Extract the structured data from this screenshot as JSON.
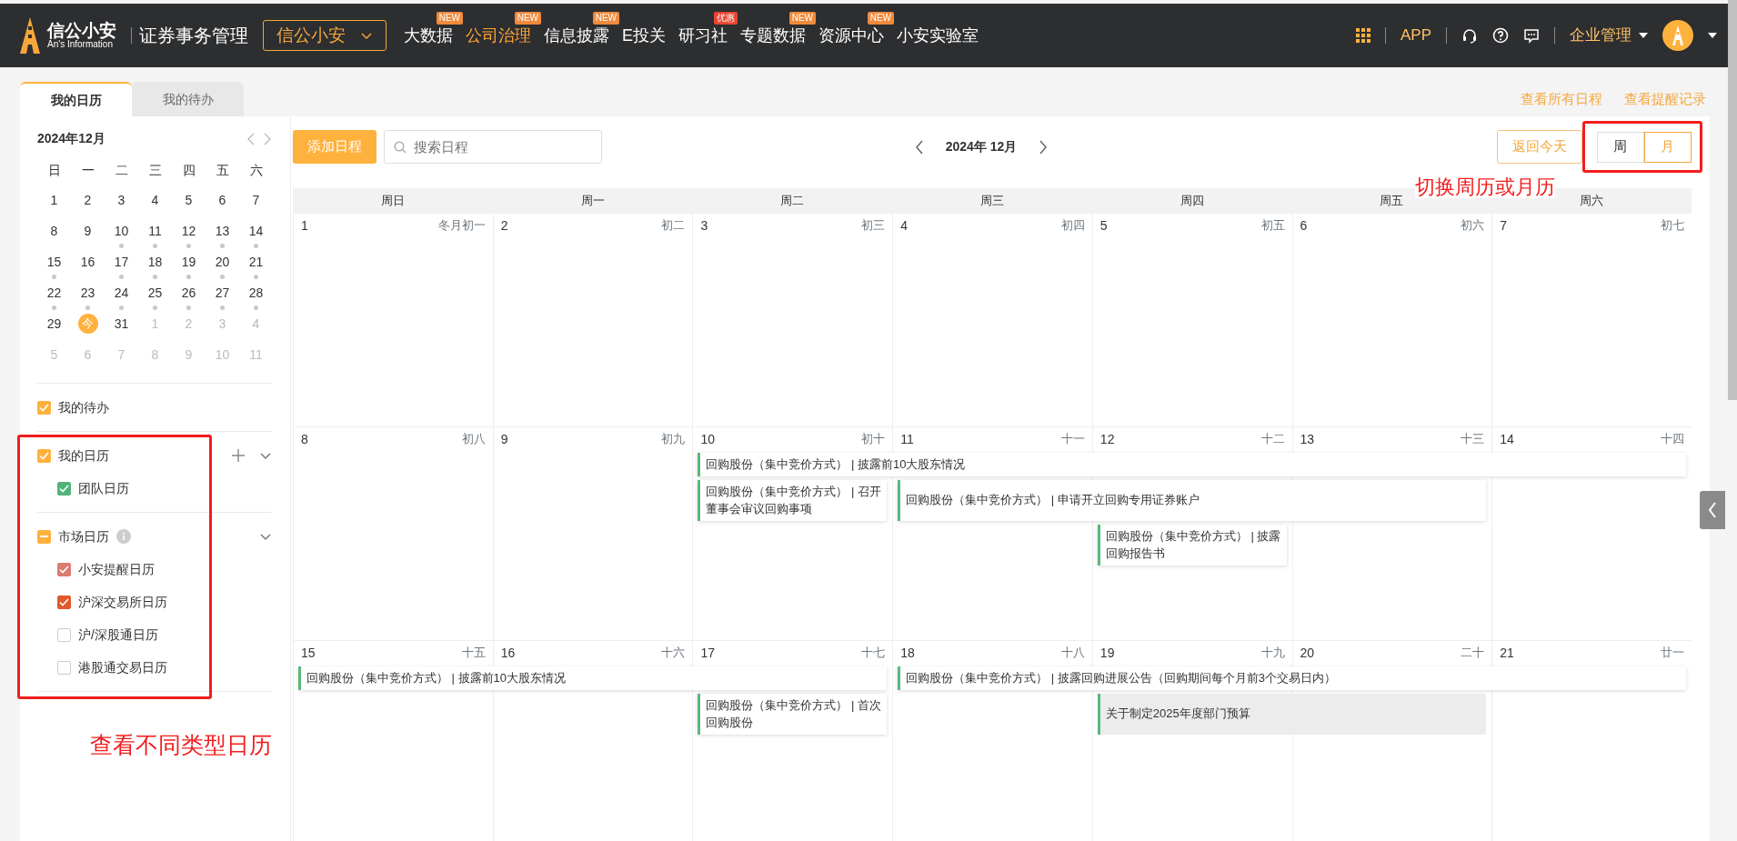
{
  "topbar": {
    "brand": {
      "name": "信公小安",
      "tagline": "An's Information"
    },
    "product": "证券事务管理",
    "product_switch": {
      "label": "信公小安"
    },
    "nav": [
      {
        "label": "大数据",
        "badge": {
          "text": "NEW",
          "color": "#f08a3c"
        },
        "selected": false
      },
      {
        "label": "公司治理",
        "badge": {
          "text": "NEW",
          "color": "#f08a3c"
        },
        "selected": true
      },
      {
        "label": "信息披露",
        "badge": {
          "text": "NEW",
          "color": "#f08a3c"
        },
        "selected": false
      },
      {
        "label": "E投关",
        "selected": false
      },
      {
        "label": "研习社",
        "badge": {
          "text": "优惠",
          "color": "#e9442f"
        },
        "selected": false
      },
      {
        "label": "专题数据",
        "badge": {
          "text": "NEW",
          "color": "#f08a3c"
        },
        "selected": false
      },
      {
        "label": "资源中心",
        "badge": {
          "text": "NEW",
          "color": "#f08a3c"
        },
        "selected": false
      },
      {
        "label": "小安实验室",
        "selected": false
      }
    ],
    "app_label": "APP",
    "account_menu": "企业管理"
  },
  "sidebar": {
    "tabs": [
      {
        "label": "我的日历",
        "selected": true
      },
      {
        "label": "我的待办",
        "selected": false
      }
    ],
    "mini_calendar": {
      "title": "2024年12月",
      "weekdays": [
        "日",
        "一",
        "二",
        "三",
        "四",
        "五",
        "六"
      ],
      "weeks": [
        [
          {
            "label": "1",
            "muted": false,
            "dot": false,
            "today": false
          },
          {
            "label": "2",
            "muted": false,
            "dot": false,
            "today": false
          },
          {
            "label": "3",
            "muted": false,
            "dot": false,
            "today": false
          },
          {
            "label": "4",
            "muted": false,
            "dot": false,
            "today": false
          },
          {
            "label": "5",
            "muted": false,
            "dot": false,
            "today": false
          },
          {
            "label": "6",
            "muted": false,
            "dot": false,
            "today": false
          },
          {
            "label": "7",
            "muted": false,
            "dot": false,
            "today": false
          }
        ],
        [
          {
            "label": "8",
            "muted": false,
            "dot": false,
            "today": false
          },
          {
            "label": "9",
            "muted": false,
            "dot": false,
            "today": false
          },
          {
            "label": "10",
            "muted": false,
            "dot": true,
            "today": false
          },
          {
            "label": "11",
            "muted": false,
            "dot": true,
            "today": false
          },
          {
            "label": "12",
            "muted": false,
            "dot": true,
            "today": false
          },
          {
            "label": "13",
            "muted": false,
            "dot": true,
            "today": false
          },
          {
            "label": "14",
            "muted": false,
            "dot": true,
            "today": false
          }
        ],
        [
          {
            "label": "15",
            "muted": false,
            "dot": true,
            "today": false
          },
          {
            "label": "16",
            "muted": false,
            "dot": false,
            "today": false
          },
          {
            "label": "17",
            "muted": false,
            "dot": true,
            "today": false
          },
          {
            "label": "18",
            "muted": false,
            "dot": true,
            "today": false
          },
          {
            "label": "19",
            "muted": false,
            "dot": true,
            "today": false
          },
          {
            "label": "20",
            "muted": false,
            "dot": true,
            "today": false
          },
          {
            "label": "21",
            "muted": false,
            "dot": true,
            "today": false
          }
        ],
        [
          {
            "label": "22",
            "muted": false,
            "dot": true,
            "today": false
          },
          {
            "label": "23",
            "muted": false,
            "dot": true,
            "today": false
          },
          {
            "label": "24",
            "muted": false,
            "dot": true,
            "today": false
          },
          {
            "label": "25",
            "muted": false,
            "dot": true,
            "today": false
          },
          {
            "label": "26",
            "muted": false,
            "dot": true,
            "today": false
          },
          {
            "label": "27",
            "muted": false,
            "dot": true,
            "today": false
          },
          {
            "label": "28",
            "muted": false,
            "dot": true,
            "today": false
          }
        ],
        [
          {
            "label": "29",
            "muted": false,
            "dot": false,
            "today": false
          },
          {
            "label": "今",
            "muted": false,
            "dot": false,
            "today": true
          },
          {
            "label": "31",
            "muted": false,
            "dot": false,
            "today": false
          },
          {
            "label": "1",
            "muted": true,
            "dot": false,
            "today": false
          },
          {
            "label": "2",
            "muted": true,
            "dot": false,
            "today": false
          },
          {
            "label": "3",
            "muted": true,
            "dot": false,
            "today": false
          },
          {
            "label": "4",
            "muted": true,
            "dot": false,
            "today": false
          }
        ],
        [
          {
            "label": "5",
            "muted": true,
            "dot": false,
            "today": false
          },
          {
            "label": "6",
            "muted": true,
            "dot": false,
            "today": false
          },
          {
            "label": "7",
            "muted": true,
            "dot": false,
            "today": false
          },
          {
            "label": "8",
            "muted": true,
            "dot": false,
            "today": false
          },
          {
            "label": "9",
            "muted": true,
            "dot": false,
            "today": false
          },
          {
            "label": "10",
            "muted": true,
            "dot": false,
            "today": false
          },
          {
            "label": "11",
            "muted": true,
            "dot": false,
            "today": false
          }
        ]
      ]
    },
    "calendars": [
      {
        "label": "我的待办",
        "checked": true,
        "color": "#ffb13d"
      },
      {
        "label": "我的日历",
        "checked": true,
        "color": "#ffb13d",
        "addable": true,
        "expanded": true,
        "children": [
          {
            "label": "团队日历",
            "checked": true,
            "color": "#52b27a"
          }
        ]
      },
      {
        "label": "市场日历",
        "partial": true,
        "color": "#ffb13d",
        "expanded": true,
        "info": true,
        "children": [
          {
            "label": "小安提醒日历",
            "checked": true,
            "color": "#dc7b70"
          },
          {
            "label": "沪深交易所日历",
            "checked": true,
            "color": "#e05a2c"
          },
          {
            "label": "沪/深股通日历",
            "checked": false
          },
          {
            "label": "港股通交易日历",
            "checked": false
          }
        ]
      }
    ],
    "annotation": "查看不同类型日历"
  },
  "links": [
    "查看所有日程",
    "查看提醒记录"
  ],
  "toolbar": {
    "add_button": "添加日程",
    "search": {
      "placeholder": "搜索日程"
    },
    "month": "2024年 12月",
    "today_button": "返回今天",
    "view_toggle": [
      {
        "label": "周",
        "selected": false
      },
      {
        "label": "月",
        "selected": true
      }
    ],
    "annotation": "切换周历或月历"
  },
  "calendar": {
    "weekdays": [
      "周日",
      "周一",
      "周二",
      "周三",
      "周四",
      "周五",
      "周六"
    ],
    "weeks": [
      {
        "days": [
          {
            "date": "1",
            "lunar": "冬月初一"
          },
          {
            "date": "2",
            "lunar": "初二"
          },
          {
            "date": "3",
            "lunar": "初三"
          },
          {
            "date": "4",
            "lunar": "初四"
          },
          {
            "date": "5",
            "lunar": "初五"
          },
          {
            "date": "6",
            "lunar": "初六"
          },
          {
            "date": "7",
            "lunar": "初七"
          }
        ]
      },
      {
        "days": [
          {
            "date": "8",
            "lunar": "初八"
          },
          {
            "date": "9",
            "lunar": "初九"
          },
          {
            "date": "10",
            "lunar": "初十"
          },
          {
            "date": "11",
            "lunar": "十一"
          },
          {
            "date": "12",
            "lunar": "十二"
          },
          {
            "date": "13",
            "lunar": "十三"
          },
          {
            "date": "14",
            "lunar": "十四"
          }
        ],
        "lanes": [
          [
            {
              "kind": "empty"
            },
            {
              "kind": "empty"
            },
            {
              "kind": "event",
              "text": "回购股份（集中竞价方式） | 披露前10大股东情况",
              "selected": false
            },
            {
              "kind": "continues"
            },
            {
              "kind": "continues"
            },
            {
              "kind": "continues"
            },
            {
              "kind": "continues"
            }
          ],
          [
            {
              "kind": "empty"
            },
            {
              "kind": "empty"
            },
            {
              "kind": "event",
              "text": "回购股份（集中竞价方式） | 召开董事会审议回购事项",
              "selected": false
            },
            {
              "kind": "event",
              "text": "回购股份（集中竞价方式） | 申请开立回购专用证券账户",
              "selected": false
            },
            {
              "kind": "continues"
            },
            {
              "kind": "continues"
            },
            {
              "kind": "empty"
            }
          ],
          [
            {
              "kind": "empty"
            },
            {
              "kind": "empty"
            },
            {
              "kind": "empty"
            },
            {
              "kind": "empty"
            },
            {
              "kind": "event",
              "text": "回购股份（集中竞价方式） | 披露回购报告书",
              "selected": false
            },
            {
              "kind": "empty"
            },
            {
              "kind": "empty"
            }
          ]
        ]
      },
      {
        "days": [
          {
            "date": "15",
            "lunar": "十五"
          },
          {
            "date": "16",
            "lunar": "十六"
          },
          {
            "date": "17",
            "lunar": "十七"
          },
          {
            "date": "18",
            "lunar": "十八"
          },
          {
            "date": "19",
            "lunar": "十九"
          },
          {
            "date": "20",
            "lunar": "二十"
          },
          {
            "date": "21",
            "lunar": "廿一"
          }
        ],
        "lanes": [
          [
            {
              "kind": "event",
              "text": "回购股份（集中竞价方式） | 披露前10大股东情况",
              "selected": false
            },
            {
              "kind": "continues"
            },
            {
              "kind": "continues"
            },
            {
              "kind": "event",
              "text": "回购股份（集中竞价方式） | 披露回购进展公告（回购期间每个月前3个交易日内）",
              "selected": false
            },
            {
              "kind": "continues"
            },
            {
              "kind": "continues"
            },
            {
              "kind": "continues"
            }
          ],
          [
            {
              "kind": "empty"
            },
            {
              "kind": "empty"
            },
            {
              "kind": "event",
              "text": "回购股份（集中竞价方式） | 首次回购股份",
              "selected": false
            },
            {
              "kind": "empty"
            },
            {
              "kind": "event",
              "text": "关于制定2025年度部门预算",
              "selected": true
            },
            {
              "kind": "continues"
            },
            {
              "kind": "empty"
            }
          ]
        ]
      }
    ]
  }
}
